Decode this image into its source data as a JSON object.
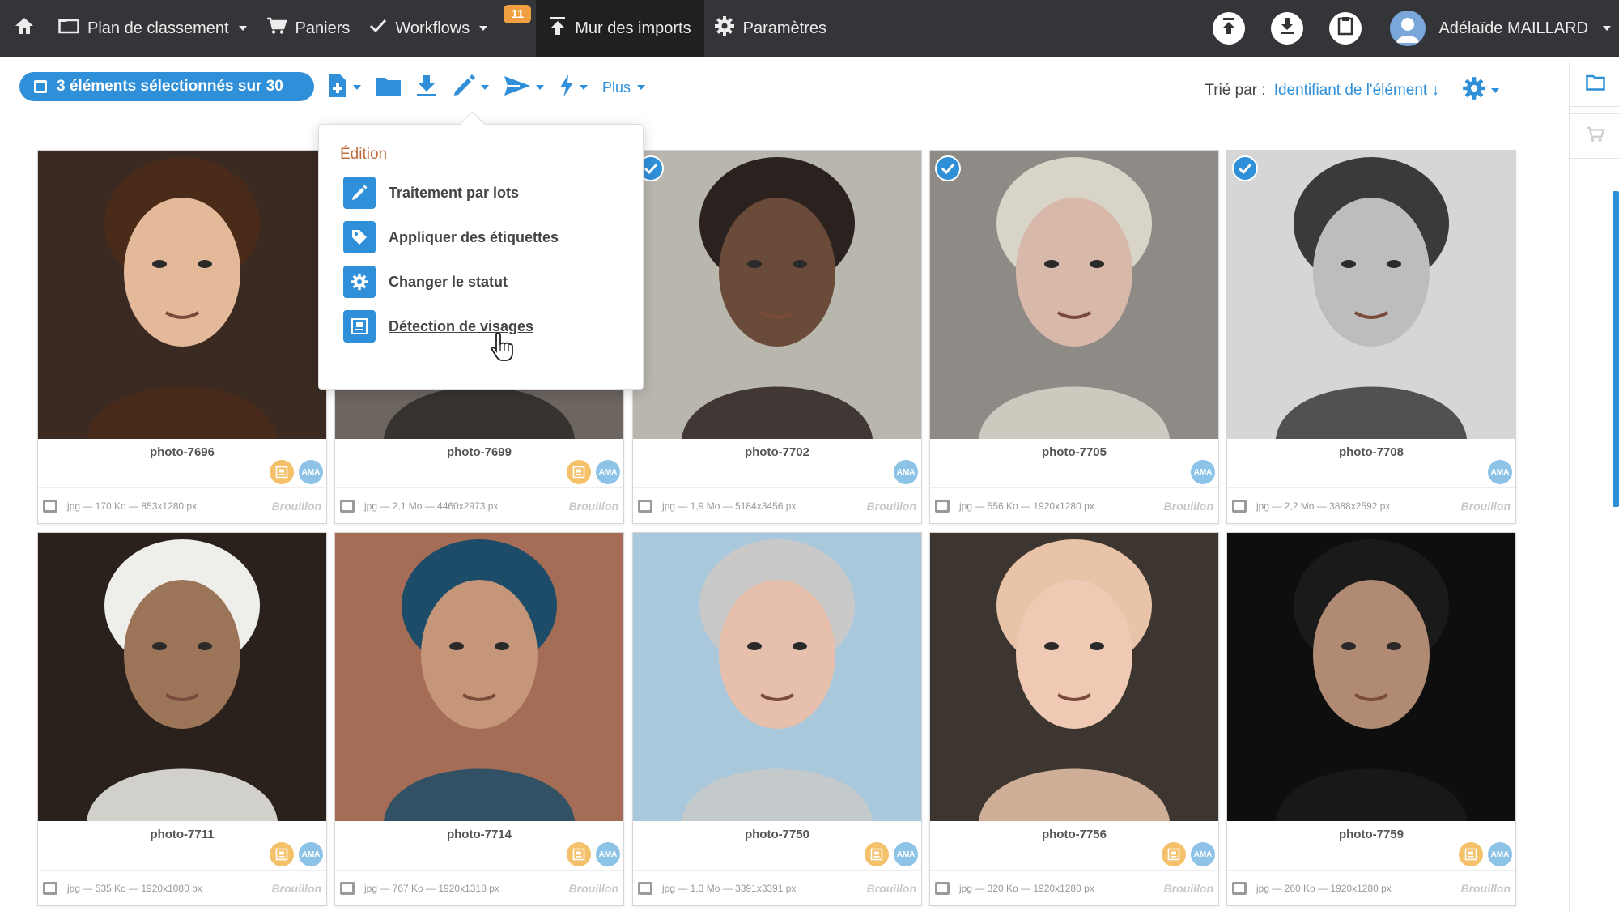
{
  "nav": {
    "items": [
      {
        "label": "Plan de classement",
        "dropdown": true
      },
      {
        "label": "Paniers"
      },
      {
        "label": "Workflows",
        "dropdown": true,
        "badge": "11"
      },
      {
        "label": "Mur des imports",
        "active": true
      },
      {
        "label": "Paramètres"
      }
    ],
    "user_name": "Adélaïde MAILLARD"
  },
  "toolbar": {
    "selection": "3 éléments sélectionnés sur 30",
    "more_label": "Plus",
    "sort_prefix": "Trié par :",
    "sort_value": "Identifiant de l'élément ↓"
  },
  "menu": {
    "title": "Édition",
    "items": [
      {
        "label": "Traitement par lots",
        "icon": "pencil-icon"
      },
      {
        "label": "Appliquer des étiquettes",
        "icon": "tag-icon"
      },
      {
        "label": "Changer le statut",
        "icon": "gear-icon"
      },
      {
        "label": "Détection de visages",
        "icon": "face-frame-icon",
        "hover": true
      }
    ]
  },
  "cards": [
    {
      "name": "photo-7696",
      "meta": "jpg — 170 Ko — 853x1280 px",
      "status": "Brouillon",
      "owner": "AMA",
      "selected": false,
      "has_orange": true
    },
    {
      "name": "photo-7699",
      "meta": "jpg — 2,1 Mo — 4460x2973 px",
      "status": "Brouillon",
      "owner": "AMA",
      "selected": false,
      "has_orange": true
    },
    {
      "name": "photo-7702",
      "meta": "jpg — 1,9 Mo — 5184x3456 px",
      "status": "Brouillon",
      "owner": "AMA",
      "selected": true,
      "has_orange": false
    },
    {
      "name": "photo-7705",
      "meta": "jpg — 556 Ko — 1920x1280 px",
      "status": "Brouillon",
      "owner": "AMA",
      "selected": true,
      "has_orange": false
    },
    {
      "name": "photo-7708",
      "meta": "jpg — 2,2 Mo — 3888x2592 px",
      "status": "Brouillon",
      "owner": "AMA",
      "selected": true,
      "has_orange": false
    },
    {
      "name": "photo-7711",
      "meta": "jpg — 535 Ko — 1920x1080 px",
      "status": "Brouillon",
      "owner": "AMA",
      "selected": false,
      "has_orange": true
    },
    {
      "name": "photo-7714",
      "meta": "jpg — 767 Ko — 1920x1318 px",
      "status": "Brouillon",
      "owner": "AMA",
      "selected": false,
      "has_orange": true
    },
    {
      "name": "photo-7750",
      "meta": "jpg — 1,3 Mo — 3391x3391 px",
      "status": "Brouillon",
      "owner": "AMA",
      "selected": false,
      "has_orange": true
    },
    {
      "name": "photo-7756",
      "meta": "jpg — 320 Ko — 1920x1280 px",
      "status": "Brouillon",
      "owner": "AMA",
      "selected": false,
      "has_orange": true
    },
    {
      "name": "photo-7759",
      "meta": "jpg — 260 Ko — 1920x1280 px",
      "status": "Brouillon",
      "owner": "AMA",
      "selected": false,
      "has_orange": true
    }
  ],
  "colors": {
    "accent": "#2f8fd8",
    "nav_bg": "#333538",
    "badge": "#f0a040",
    "menu_title": "#c0693a"
  }
}
